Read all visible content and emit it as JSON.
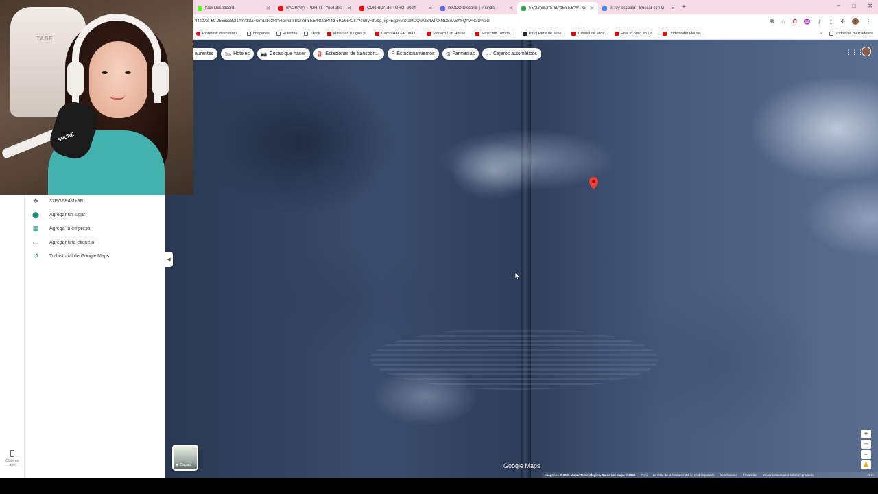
{
  "browser": {
    "tabs": [
      {
        "title": "Kick Dashboard",
        "color": "#53fc18",
        "active": false
      },
      {
        "title": "BACHATA - POR TI - YouTube",
        "color": "#ff0000",
        "active": false
      },
      {
        "title": "CORRIDA de TORO: 2024",
        "color": "#ff0000",
        "active": false
      },
      {
        "title": "(SODO Discord) | # kinda",
        "color": "#5865f2",
        "active": false
      },
      {
        "title": "55°32'38.8\"S 69°15'55.5\"W - G",
        "color": "#34a853",
        "active": true
      },
      {
        "title": "el rey escobar - Buscar con G",
        "color": "#4285f4",
        "active": false
      }
    ],
    "url": "444073,-69.2666338,214m/data=!3m1!1e3!4m4!3m3!8m2!3d-55.5440984!4d-69.2654287?entry=ttu&g_ep=EgoyMDI2MDQwMS4wIKXMDSoASAFQAw%3D%3D",
    "window_controls": [
      "–",
      "□",
      "✕"
    ],
    "bookmarks": [
      {
        "label": "Pinterest: descubre i...",
        "icon": "pin"
      },
      {
        "label": "Imagenes",
        "icon": "fold"
      },
      {
        "label": "Ruletitas",
        "icon": "fold"
      },
      {
        "label": "Tiktok",
        "icon": "fold"
      },
      {
        "label": "Minecraft Plugins p...",
        "icon": "yt"
      },
      {
        "label": "Como HACER una C...",
        "icon": "yt"
      },
      {
        "label": "Modern Cliff House...",
        "icon": "yt"
      },
      {
        "label": "Minecraft Tutorial |...",
        "icon": "yt"
      },
      {
        "label": "kitty | Perfil de Mine...",
        "icon": "kt"
      },
      {
        "label": "Tutorial de Mine...",
        "icon": "yt"
      },
      {
        "label": "How to build an Un...",
        "icon": "yt"
      },
      {
        "label": "Underwater House...",
        "icon": "yt"
      }
    ],
    "bookmarks_more": "»",
    "all_bookmarks": "Todos los marcadores"
  },
  "map": {
    "chips": [
      {
        "label": "aurantes",
        "icon": ""
      },
      {
        "label": "Hoteles",
        "icon": "🛏"
      },
      {
        "label": "Cosas que hacer",
        "icon": "📷"
      },
      {
        "label": "Estaciones de transport...",
        "icon": "⛽"
      },
      {
        "label": "Estacionamientos",
        "icon": "P"
      },
      {
        "label": "Farmacias",
        "icon": "⊞"
      },
      {
        "label": "Cajeros automáticos",
        "icon": "⊶"
      }
    ],
    "logo": "Google Maps",
    "attribution": [
      {
        "text": "Imágenes © 2026 Maxar Technologies, Datos del mapa © 2026",
        "strong": true
      },
      {
        "text": "Perú",
        "strong": false
      },
      {
        "text": "La vista de la Tierra en 3D no está disponible",
        "strong": false
      },
      {
        "text": "Condiciones",
        "strong": false
      },
      {
        "text": "Privacidad",
        "strong": false
      },
      {
        "text": "Enviar comentarios sobre el producto",
        "strong": false
      }
    ],
    "scale": "10 m",
    "layers_label": "Capas",
    "controls": {
      "locate": "⌖",
      "zoom_in": "+",
      "zoom_out": "−",
      "pegman": "♟"
    }
  },
  "panel": {
    "items": [
      {
        "icon": "✥",
        "label": "37PGFP4M+9R",
        "icon_class": "grey"
      },
      {
        "icon": "⬤",
        "label": "Agregar un lugar",
        "icon_class": ""
      },
      {
        "icon": "▦",
        "label": "Agrega tu empresa",
        "icon_class": ""
      },
      {
        "icon": "▭",
        "label": "Agregar una etiqueta",
        "icon_class": "grey"
      },
      {
        "icon": "↺",
        "label": "Tu historial de Google Maps",
        "icon_class": ""
      }
    ],
    "collapse_icon": "◀",
    "get_app": "Obtener app"
  },
  "webcam": {
    "chair_brand": "TASE",
    "mic_label": "SHURE"
  }
}
